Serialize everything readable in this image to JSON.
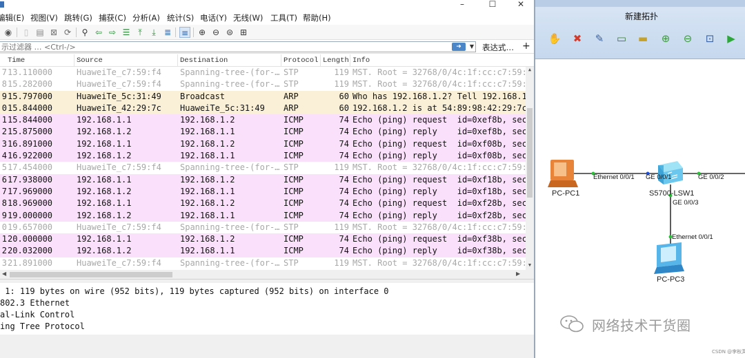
{
  "wireshark": {
    "menu": [
      "编辑(E)",
      "视图(V)",
      "跳转(G)",
      "捕获(C)",
      "分析(A)",
      "统计(S)",
      "电话(Y)",
      "无线(W)",
      "工具(T)",
      "帮助(H)"
    ],
    "filter": {
      "placeholder": "示过滤器 … <Ctrl-/>",
      "expression_label": "表达式…",
      "add_label": "+"
    },
    "columns": [
      "Time",
      "Source",
      "Destination",
      "Protocol",
      "Length",
      "Info"
    ],
    "packets": [
      {
        "no": "7",
        "time": "13.110000",
        "src": "HuaweiTe_c7:59:f4",
        "dst": "Spanning-tree-(for-…",
        "proto": "STP",
        "len": "119",
        "info": "MST. Root = 32768/0/4c:1f:cc:c7:59:",
        "kind": "stp"
      },
      {
        "no": "8",
        "time": "15.282000",
        "src": "HuaweiTe_c7:59:f4",
        "dst": "Spanning-tree-(for-…",
        "proto": "STP",
        "len": "119",
        "info": "MST. Root = 32768/0/4c:1f:cc:c7:59:",
        "kind": "stp"
      },
      {
        "no": "9",
        "time": "15.797000",
        "src": "HuaweiTe_5c:31:49",
        "dst": "Broadcast",
        "proto": "ARP",
        "len": "60",
        "info": "Who has 192.168.1.2? Tell 192.168.1",
        "kind": "arp"
      },
      {
        "no": "0",
        "time": "15.844000",
        "src": "HuaweiTe_42:29:7c",
        "dst": "HuaweiTe_5c:31:49",
        "proto": "ARP",
        "len": "60",
        "info": "192.168.1.2 is at 54:89:98:42:29:7c",
        "kind": "arp"
      },
      {
        "no": "1",
        "time": "15.844000",
        "src": "192.168.1.1",
        "dst": "192.168.1.2",
        "proto": "ICMP",
        "len": "74",
        "info": "Echo (ping) request  id=0xef8b, sec",
        "kind": "icmp"
      },
      {
        "no": "2",
        "time": "15.875000",
        "src": "192.168.1.2",
        "dst": "192.168.1.1",
        "proto": "ICMP",
        "len": "74",
        "info": "Echo (ping) reply    id=0xef8b, sec",
        "kind": "icmp"
      },
      {
        "no": "3",
        "time": "16.891000",
        "src": "192.168.1.1",
        "dst": "192.168.1.2",
        "proto": "ICMP",
        "len": "74",
        "info": "Echo (ping) request  id=0xf08b, sec",
        "kind": "icmp"
      },
      {
        "no": "4",
        "time": "16.922000",
        "src": "192.168.1.2",
        "dst": "192.168.1.1",
        "proto": "ICMP",
        "len": "74",
        "info": "Echo (ping) reply    id=0xf08b, sec",
        "kind": "icmp"
      },
      {
        "no": "5",
        "time": "17.454000",
        "src": "HuaweiTe_c7:59:f4",
        "dst": "Spanning-tree-(for-…",
        "proto": "STP",
        "len": "119",
        "info": "MST. Root = 32768/0/4c:1f:cc:c7:59:",
        "kind": "stp"
      },
      {
        "no": "6",
        "time": "17.938000",
        "src": "192.168.1.1",
        "dst": "192.168.1.2",
        "proto": "ICMP",
        "len": "74",
        "info": "Echo (ping) request  id=0xf18b, sec",
        "kind": "icmp"
      },
      {
        "no": "7",
        "time": "17.969000",
        "src": "192.168.1.2",
        "dst": "192.168.1.1",
        "proto": "ICMP",
        "len": "74",
        "info": "Echo (ping) reply    id=0xf18b, sec",
        "kind": "icmp"
      },
      {
        "no": "8",
        "time": "18.969000",
        "src": "192.168.1.1",
        "dst": "192.168.1.2",
        "proto": "ICMP",
        "len": "74",
        "info": "Echo (ping) request  id=0xf28b, sec",
        "kind": "icmp"
      },
      {
        "no": "9",
        "time": "19.000000",
        "src": "192.168.1.2",
        "dst": "192.168.1.1",
        "proto": "ICMP",
        "len": "74",
        "info": "Echo (ping) reply    id=0xf28b, sec",
        "kind": "icmp"
      },
      {
        "no": "0",
        "time": "19.657000",
        "src": "HuaweiTe_c7:59:f4",
        "dst": "Spanning-tree-(for-…",
        "proto": "STP",
        "len": "119",
        "info": "MST. Root = 32768/0/4c:1f:cc:c7:59:",
        "kind": "stp"
      },
      {
        "no": "1",
        "time": "20.000000",
        "src": "192.168.1.1",
        "dst": "192.168.1.2",
        "proto": "ICMP",
        "len": "74",
        "info": "Echo (ping) request  id=0xf38b, sec",
        "kind": "icmp"
      },
      {
        "no": "2",
        "time": "20.032000",
        "src": "192.168.1.2",
        "dst": "192.168.1.1",
        "proto": "ICMP",
        "len": "74",
        "info": "Echo (ping) reply    id=0xf38b, sec",
        "kind": "icmp"
      },
      {
        "no": "3",
        "time": "21.891000",
        "src": "HuaweiTe_c7:59:f4",
        "dst": "Spanning-tree-(for-…",
        "proto": "STP",
        "len": "119",
        "info": "MST. Root = 32768/0/4c:1f:cc:c7:59:",
        "kind": "stp"
      }
    ],
    "detail_lines": [
      " 1: 119 bytes on wire (952 bits), 119 bytes captured (952 bits) on interface 0",
      "802.3 Ethernet",
      "al-Link Control",
      "ing Tree Protocol"
    ],
    "colors": {
      "stp_text": "#a8a8a8",
      "arp_bg": "#faf0d7",
      "icmp_bg": "#fbe0fb"
    }
  },
  "ensp": {
    "title": "新建拓扑",
    "devices": {
      "pc1": "PC-PC1",
      "switch": "S5700-LSW1",
      "pc3": "PC-PC3"
    },
    "ports": {
      "pc1_eth": "Ethernet 0/0/1",
      "sw_ge1": "GE 0/0/1",
      "sw_ge2": "GE 0/0/2",
      "sw_ge3": "GE 0/0/3",
      "pc3_eth": "Ethernet 0/0/1"
    },
    "watermark": "网络技术干货圈",
    "csdn": "CSDN @李秋芙"
  }
}
